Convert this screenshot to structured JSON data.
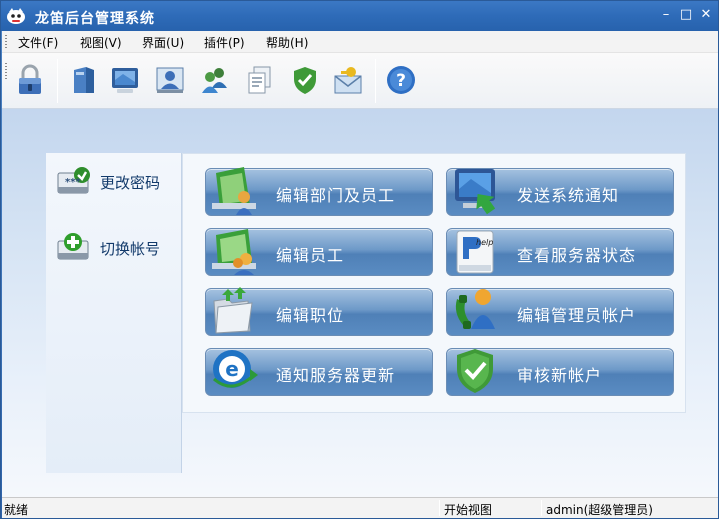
{
  "window": {
    "title": "龙笛后台管理系统"
  },
  "window_controls": {
    "minimize": "–",
    "maximize": "□",
    "close": "✕"
  },
  "menubar": {
    "items": [
      {
        "label": "文件(F)"
      },
      {
        "label": "视图(V)"
      },
      {
        "label": "界面(U)"
      },
      {
        "label": "插件(P)"
      },
      {
        "label": "帮助(H)"
      }
    ]
  },
  "toolbar": {
    "buttons": [
      {
        "icon": "lock-icon"
      },
      {
        "icon": "book-icon"
      },
      {
        "icon": "monitor-icon"
      },
      {
        "icon": "user-card-icon"
      },
      {
        "icon": "users-icon"
      },
      {
        "icon": "documents-icon"
      },
      {
        "icon": "shield-check-icon"
      },
      {
        "icon": "mail-key-icon"
      },
      {
        "icon": "help-icon"
      }
    ]
  },
  "left_panel": {
    "items": [
      {
        "label": "更改密码",
        "icon": "change-password-icon"
      },
      {
        "label": "切换帐号",
        "icon": "switch-account-icon"
      }
    ]
  },
  "actions": {
    "items": [
      {
        "label": "编辑部门及员工",
        "icon": "department-icon"
      },
      {
        "label": "发送系统通知",
        "icon": "send-notice-icon"
      },
      {
        "label": "编辑员工",
        "icon": "employee-icon"
      },
      {
        "label": "查看服务器状态",
        "icon": "server-help-icon"
      },
      {
        "label": "编辑职位",
        "icon": "position-folder-icon"
      },
      {
        "label": "编辑管理员帐户",
        "icon": "admin-account-icon"
      },
      {
        "label": "通知服务器更新",
        "icon": "update-icon"
      },
      {
        "label": "审核新帐户",
        "icon": "approve-account-icon"
      }
    ]
  },
  "statusbar": {
    "status": "就绪",
    "view": "开始视图",
    "user": "admin(超级管理员)"
  },
  "colors": {
    "title_bar": "#2e6bb8",
    "action_button": "#5a8cc2",
    "workspace": "#d6e4f4"
  }
}
